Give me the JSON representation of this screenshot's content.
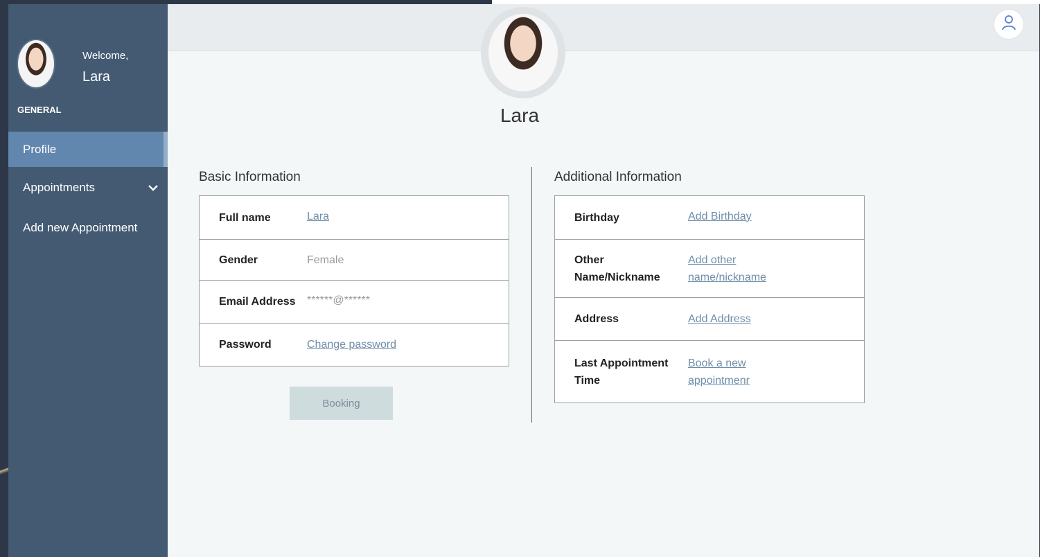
{
  "sidebar": {
    "welcome": "Welcome,",
    "user_name": "Lara",
    "section": "GENERAL",
    "items": [
      {
        "label": "Profile",
        "active": true
      },
      {
        "label": "Appointments",
        "has_submenu": true
      },
      {
        "label": "Add new Appointment"
      }
    ]
  },
  "profile": {
    "name": "Lara"
  },
  "basic_info": {
    "title": "Basic Information",
    "rows": [
      {
        "label": "Full name",
        "value": "Lara"
      },
      {
        "label": "Gender",
        "value": "Female"
      },
      {
        "label": "Email Address",
        "value": "******@******"
      },
      {
        "label": "Password",
        "value": "Change password"
      }
    ]
  },
  "additional_info": {
    "title": "Additional Information",
    "rows": [
      {
        "label": "Birthday",
        "value": "Add Birthday"
      },
      {
        "label": "Other Name/Nickname",
        "value": "Add other name/nickname"
      },
      {
        "label": "Address",
        "value": "Add Address"
      },
      {
        "label": "Last Appointment Time",
        "value": "Book a new appointmenr"
      }
    ]
  },
  "booking_button": "Booking",
  "colors": {
    "sidebar_bg": "#435a72",
    "active_item": "#6287ae",
    "link": "#6f8ea9",
    "main_bg": "#f3f7f8"
  }
}
